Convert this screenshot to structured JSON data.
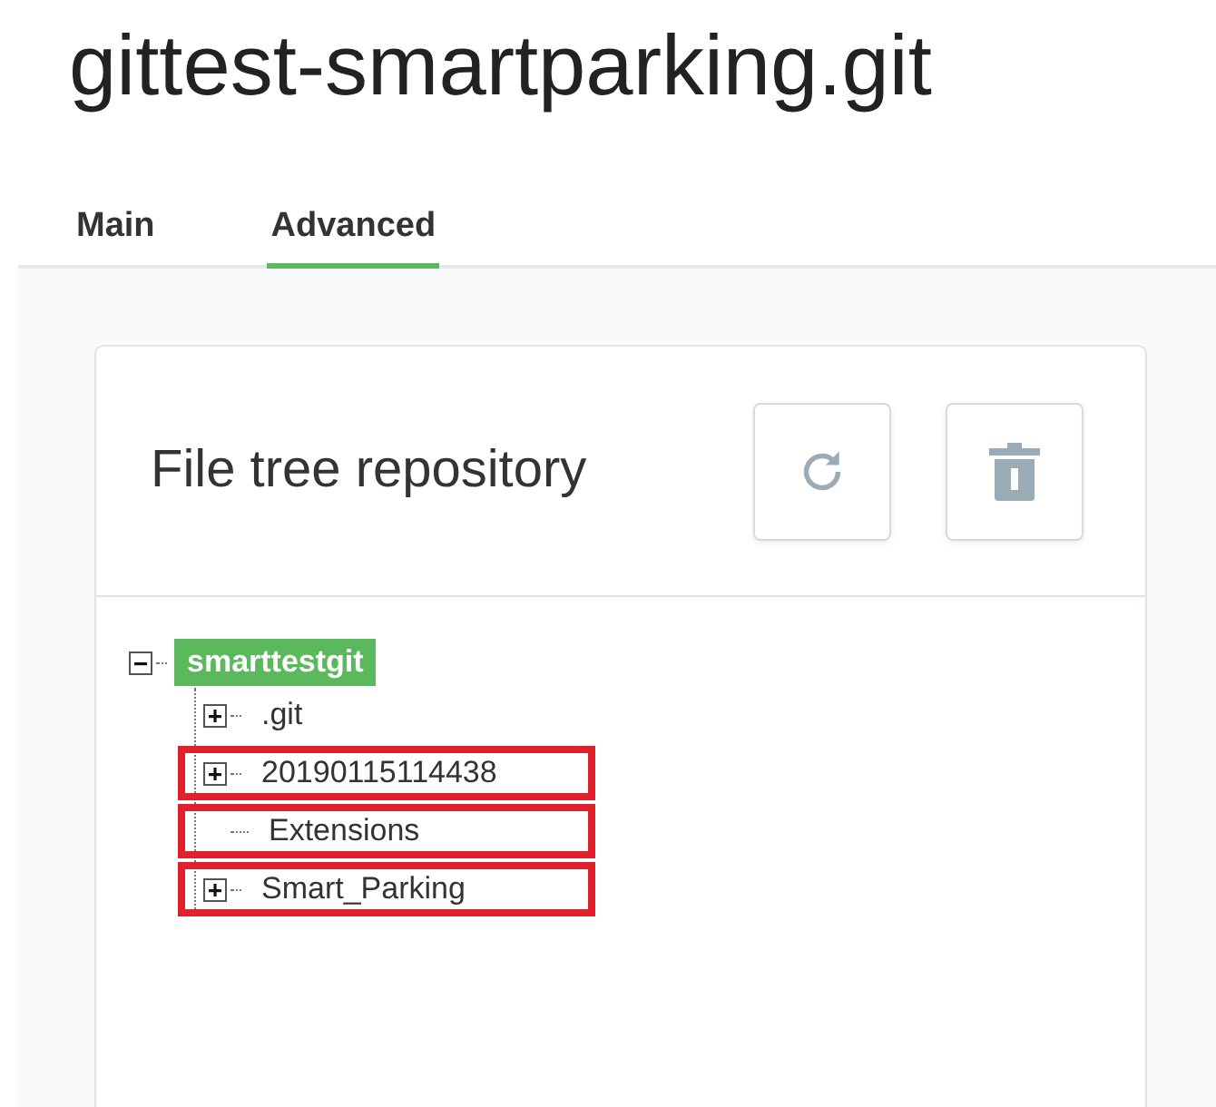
{
  "title": "gittest-smartparking.git",
  "tabs": [
    {
      "label": "Main",
      "selected": false
    },
    {
      "label": "Advanced",
      "selected": true
    }
  ],
  "panel": {
    "title": "File tree repository",
    "tree": [
      {
        "label": "smarttestgit",
        "selected": true,
        "expanded": true,
        "children": [
          {
            "label": ".git",
            "selected": false,
            "expandable": true,
            "highlighted": false
          },
          {
            "label": "20190115114438",
            "selected": false,
            "expandable": true,
            "highlighted": true
          },
          {
            "label": "Extensions",
            "selected": false,
            "expandable": false,
            "highlighted": true
          },
          {
            "label": "Smart_Parking",
            "selected": false,
            "expandable": true,
            "highlighted": true
          }
        ]
      }
    ]
  }
}
